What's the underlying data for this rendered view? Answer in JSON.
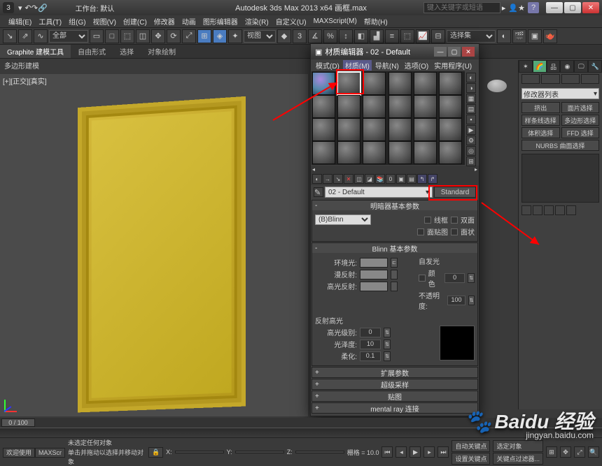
{
  "titlebar": {
    "workspace_label": "工作台: 默认",
    "app_title": "Autodesk 3ds Max  2013  x64   画框.max",
    "search_placeholder": "键入关键字或短语"
  },
  "menubar": {
    "items": [
      "编辑(E)",
      "工具(T)",
      "组(G)",
      "视图(V)",
      "创建(C)",
      "修改器",
      "动画",
      "图形编辑器",
      "渲染(R)",
      "自定义(U)",
      "MAXScript(M)",
      "帮助(H)"
    ]
  },
  "toolbar1": {
    "scope": "全部",
    "view_label": "视图",
    "set_label": "选择集"
  },
  "ribbon": {
    "tabs": [
      "Graphite 建模工具",
      "自由形式",
      "选择",
      "对象绘制"
    ],
    "sublabel": "多边形建模"
  },
  "viewport": {
    "label": "[+][正交][真实]"
  },
  "matwin": {
    "title": "材质编辑器 - 02 - Default",
    "menus": [
      "模式(D)",
      "材质(M)",
      "导航(N)",
      "选项(O)",
      "实用程序(U)"
    ],
    "mat_name": "02 - Default",
    "std_btn": "Standard",
    "rollups": {
      "shader": {
        "title": "明暗器基本参数",
        "shader": "(B)Blinn",
        "wire": "线框",
        "two_sided": "双面",
        "face_map": "面贴图",
        "faceted": "面状"
      },
      "blinn": {
        "title": "Blinn 基本参数",
        "ambient": "环境光:",
        "diffuse": "漫反射:",
        "specc": "高光反射:",
        "selfillum": "自发光",
        "color_cb": "颜色",
        "selfillum_val": "0",
        "opacity": "不透明度:",
        "opacity_val": "100",
        "sec_title": "反射高光",
        "spec_level": "高光级别:",
        "spec_level_val": "0",
        "gloss": "光泽度:",
        "gloss_val": "10",
        "soften": "柔化:",
        "soften_val": "0.1"
      },
      "extended": "扩展参数",
      "super": "超级采样",
      "maps": "贴图",
      "mental": "mental ray 连接"
    }
  },
  "rightpanel": {
    "combo": "修改器列表",
    "buttons": [
      "挤出",
      "面片选择",
      "样条线选择",
      "多边形选择",
      "体积选择",
      "FFD 选择",
      "NURBS 曲面选择"
    ]
  },
  "timeline": {
    "pos": "0 / 100"
  },
  "status": {
    "nosel": "未选定任何对象",
    "hint": "单击并拖动以选择并移动对象",
    "x": "X:",
    "y": "Y:",
    "z": "Z:",
    "grid": "栅格 = 10.0",
    "autokey": "自动关键点",
    "selset": "选定对象",
    "setkey": "设置关键点",
    "keyfilter": "关键点过滤器...",
    "welcome": "欢迎使用",
    "maxs": "MAXScr"
  },
  "watermark": {
    "brand": "Baidu 经验",
    "url": "jingyan.baidu.com"
  }
}
